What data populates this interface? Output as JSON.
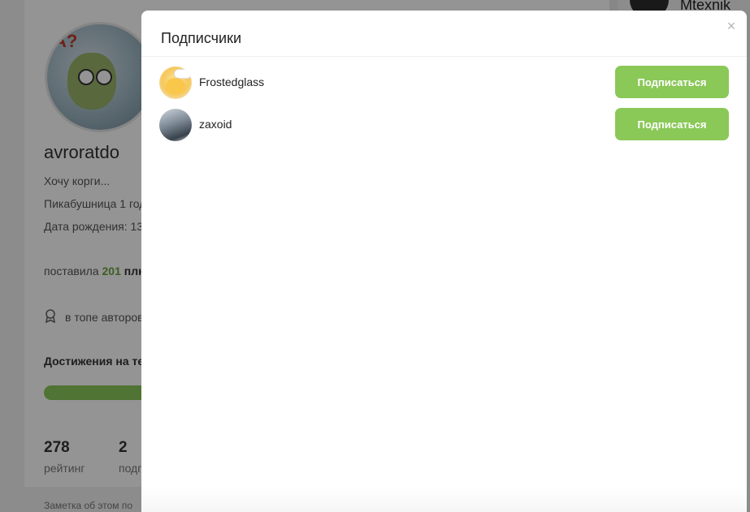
{
  "background_profile": {
    "username": "avroratdo",
    "bio": "Хочу корги...",
    "line2": "Пикабушница 1 год",
    "line3": "Дата рождения: 13",
    "pluses_prefix": "поставила",
    "pluses_count": "201",
    "pluses_suffix": "плю",
    "top_authors": "в топе авторов",
    "achievements": "Достижения на те",
    "rating_value": "278",
    "rating_label": "рейтинг",
    "subs_value": "2",
    "subs_label": "подп",
    "note": "Заметка об этом по",
    "other_user": "Mtexnik"
  },
  "modal": {
    "title": "Подписчики",
    "close_symbol": "×",
    "followers": [
      {
        "name": "Frostedglass",
        "button": "Подписаться"
      },
      {
        "name": "zaxoid",
        "button": "Подписаться"
      }
    ]
  },
  "colors": {
    "accent_green": "#8ac858",
    "overlay": "rgba(0,0,0,0.42)"
  }
}
